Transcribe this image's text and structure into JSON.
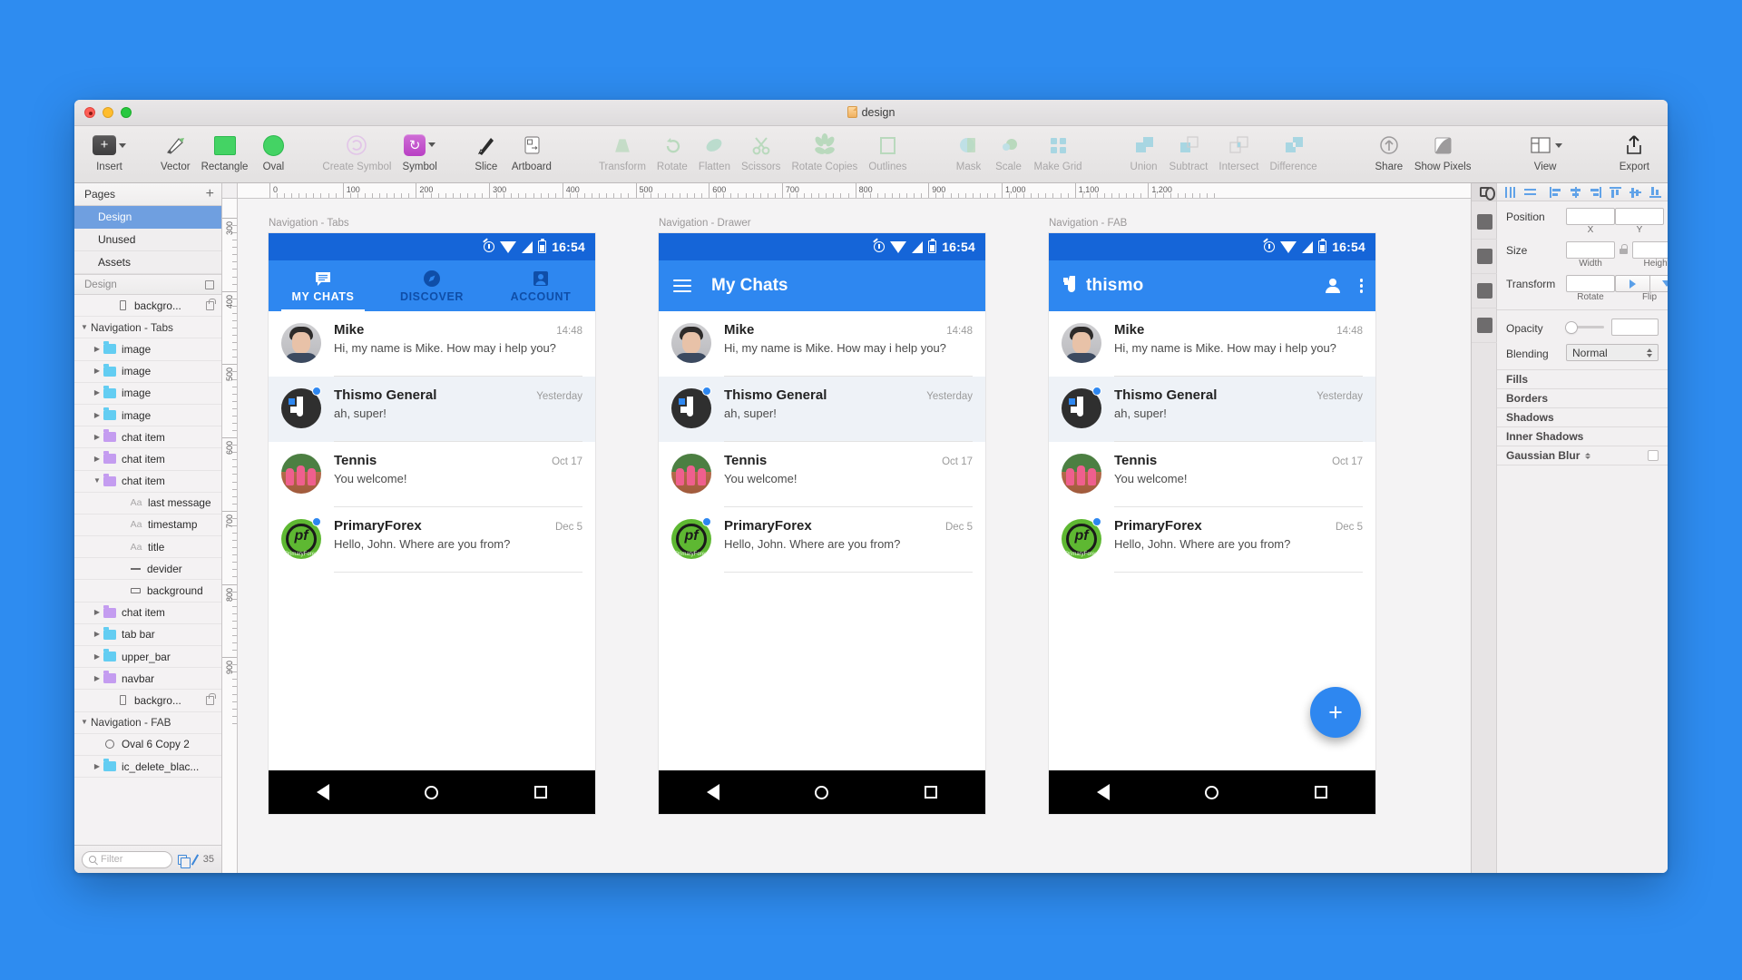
{
  "window": {
    "title": "design",
    "doc_icon": "document-icon"
  },
  "toolbar": {
    "groups": [
      {
        "items": [
          {
            "label": "Insert",
            "icon": "plus-square-icon",
            "dim": false,
            "kind": "insert"
          }
        ]
      },
      {
        "items": [
          {
            "label": "Vector",
            "icon": "pen-icon",
            "dim": false,
            "kind": "vector"
          },
          {
            "label": "Rectangle",
            "icon": "rectangle-icon",
            "dim": false,
            "kind": "rect"
          },
          {
            "label": "Oval",
            "icon": "oval-icon",
            "dim": false,
            "kind": "oval"
          }
        ]
      },
      {
        "items": [
          {
            "label": "Create Symbol",
            "icon": "create-symbol-icon",
            "dim": true,
            "kind": "createsym"
          },
          {
            "label": "Symbol",
            "icon": "symbol-icon",
            "dim": false,
            "kind": "symbol"
          }
        ]
      },
      {
        "items": [
          {
            "label": "Slice",
            "icon": "slice-icon",
            "dim": false,
            "kind": "slice"
          },
          {
            "label": "Artboard",
            "icon": "artboard-icon",
            "dim": false,
            "kind": "artboard"
          }
        ]
      },
      {
        "items": [
          {
            "label": "Transform",
            "icon": "transform-icon",
            "dim": true,
            "kind": "transform"
          },
          {
            "label": "Rotate",
            "icon": "rotate-icon",
            "dim": true,
            "kind": "rotate"
          },
          {
            "label": "Flatten",
            "icon": "flatten-icon",
            "dim": true,
            "kind": "flatten"
          },
          {
            "label": "Scissors",
            "icon": "scissors-icon",
            "dim": true,
            "kind": "scissors"
          },
          {
            "label": "Rotate Copies",
            "icon": "rotate-copies-icon",
            "dim": true,
            "kind": "rotatecopies"
          },
          {
            "label": "Outlines",
            "icon": "outlines-icon",
            "dim": true,
            "kind": "outlines"
          }
        ]
      },
      {
        "items": [
          {
            "label": "Mask",
            "icon": "mask-icon",
            "dim": true,
            "kind": "mask"
          },
          {
            "label": "Scale",
            "icon": "scale-icon",
            "dim": true,
            "kind": "scale"
          },
          {
            "label": "Make Grid",
            "icon": "make-grid-icon",
            "dim": true,
            "kind": "makegrid"
          }
        ]
      },
      {
        "items": [
          {
            "label": "Union",
            "icon": "union-icon",
            "dim": true,
            "kind": "union"
          },
          {
            "label": "Subtract",
            "icon": "subtract-icon",
            "dim": true,
            "kind": "subtract"
          },
          {
            "label": "Intersect",
            "icon": "intersect-icon",
            "dim": true,
            "kind": "intersect"
          },
          {
            "label": "Difference",
            "icon": "difference-icon",
            "dim": true,
            "kind": "difference"
          }
        ]
      },
      {
        "items": [
          {
            "label": "Share",
            "icon": "share-icon",
            "dim": false,
            "kind": "share"
          },
          {
            "label": "Show Pixels",
            "icon": "show-pixels-icon",
            "dim": false,
            "kind": "pixels"
          }
        ]
      },
      {
        "items": [
          {
            "label": "View",
            "icon": "view-icon",
            "dim": false,
            "kind": "view"
          }
        ]
      },
      {
        "items": [
          {
            "label": "Export",
            "icon": "export-icon",
            "dim": false,
            "kind": "export"
          }
        ]
      }
    ]
  },
  "sidebar": {
    "pages_title": "Pages",
    "pages": [
      {
        "label": "Design",
        "selected": true
      },
      {
        "label": "Unused",
        "selected": false
      },
      {
        "label": "Assets",
        "selected": false
      }
    ],
    "layers_title": "Design",
    "filter_placeholder": "Filter",
    "layer_count": "35",
    "layers": [
      {
        "label": "backgro...",
        "indent": 2,
        "type": "artboardlayer",
        "disc": "",
        "locked": true
      },
      {
        "label": "Navigation - Tabs",
        "indent": 0,
        "type": "group",
        "disc": "down",
        "locked": false
      },
      {
        "label": "image",
        "indent": 1,
        "type": "folder-blue",
        "disc": "right",
        "locked": false
      },
      {
        "label": "image",
        "indent": 1,
        "type": "folder-blue",
        "disc": "right",
        "locked": false
      },
      {
        "label": "image",
        "indent": 1,
        "type": "folder-blue",
        "disc": "right",
        "locked": false
      },
      {
        "label": "image",
        "indent": 1,
        "type": "folder-blue",
        "disc": "right",
        "locked": false
      },
      {
        "label": "chat item",
        "indent": 1,
        "type": "folder-purple",
        "disc": "right",
        "locked": false
      },
      {
        "label": "chat item",
        "indent": 1,
        "type": "folder-purple",
        "disc": "right",
        "locked": false
      },
      {
        "label": "chat item",
        "indent": 1,
        "type": "folder-purple",
        "disc": "down",
        "locked": false
      },
      {
        "label": "last message",
        "indent": 3,
        "type": "text",
        "disc": "",
        "locked": false
      },
      {
        "label": "timestamp",
        "indent": 3,
        "type": "text",
        "disc": "",
        "locked": false
      },
      {
        "label": "title",
        "indent": 3,
        "type": "text",
        "disc": "",
        "locked": false
      },
      {
        "label": "devider",
        "indent": 3,
        "type": "line",
        "disc": "",
        "locked": false
      },
      {
        "label": "background",
        "indent": 3,
        "type": "rect",
        "disc": "",
        "locked": false
      },
      {
        "label": "chat item",
        "indent": 1,
        "type": "folder-purple",
        "disc": "right",
        "locked": false
      },
      {
        "label": "tab bar",
        "indent": 1,
        "type": "folder-blue",
        "disc": "right",
        "locked": false
      },
      {
        "label": "upper_bar",
        "indent": 1,
        "type": "folder-blue",
        "disc": "right",
        "locked": false
      },
      {
        "label": "navbar",
        "indent": 1,
        "type": "folder-purple",
        "disc": "right",
        "locked": false
      },
      {
        "label": "backgro...",
        "indent": 2,
        "type": "artboardlayer",
        "disc": "",
        "locked": true
      },
      {
        "label": "Navigation - FAB",
        "indent": 0,
        "type": "group",
        "disc": "down",
        "locked": false
      },
      {
        "label": "Oval 6 Copy 2",
        "indent": 1,
        "type": "oval",
        "disc": "",
        "locked": false
      },
      {
        "label": "ic_delete_blac...",
        "indent": 1,
        "type": "folder-blue",
        "disc": "right",
        "locked": false
      }
    ]
  },
  "ruler": {
    "h_labels": [
      "0",
      "100",
      "200",
      "300",
      "400",
      "500",
      "600",
      "700",
      "800",
      "900",
      "1,000",
      "1,100",
      "1,200"
    ],
    "v_labels": [
      "300",
      "400",
      "500",
      "600",
      "700",
      "800",
      "900"
    ]
  },
  "artboards": [
    {
      "name": "Navigation - Tabs",
      "kind": "tabs",
      "statusbar": {
        "time": "16:54",
        "icons": [
          "alarm-icon",
          "wifi-icon",
          "signal-icon",
          "battery-icon"
        ]
      },
      "tabs": [
        {
          "label": "MY CHATS",
          "icon": "chat-icon",
          "active": true
        },
        {
          "label": "DISCOVER",
          "icon": "compass-icon",
          "active": false
        },
        {
          "label": "ACCOUNT",
          "icon": "person-icon",
          "active": false
        }
      ]
    },
    {
      "name": "Navigation - Drawer",
      "kind": "drawer",
      "statusbar": {
        "time": "16:54",
        "icons": [
          "alarm-icon",
          "wifi-icon",
          "signal-icon",
          "battery-icon"
        ]
      },
      "title": "My Chats",
      "menu_icon": "hamburger-icon"
    },
    {
      "name": "Navigation - FAB",
      "kind": "fab",
      "statusbar": {
        "time": "16:54",
        "icons": [
          "alarm-icon",
          "wifi-icon",
          "signal-icon",
          "battery-icon"
        ]
      },
      "brand": "thismo",
      "actions": [
        "person-icon",
        "overflow-menu-icon"
      ],
      "fab_label": "+"
    }
  ],
  "chats": [
    {
      "name": "Mike",
      "time": "14:48",
      "message": "Hi, my name is Mike. How may i help you?",
      "avatar": "mike",
      "badge": false,
      "highlight": false
    },
    {
      "name": "Thismo General",
      "time": "Yesterday",
      "message": "ah, super!",
      "avatar": "thismo",
      "badge": true,
      "highlight": true
    },
    {
      "name": "Tennis",
      "time": "Oct 17",
      "message": "You welcome!",
      "avatar": "tennis",
      "badge": false,
      "highlight": false
    },
    {
      "name": "PrimaryForex",
      "time": "Dec 5",
      "message": "Hello, John.  Where are you from?",
      "avatar": "pf",
      "badge": true,
      "highlight": false
    }
  ],
  "bottom_nav": [
    "back-icon",
    "home-icon",
    "recents-icon"
  ],
  "inspector": {
    "fields": {
      "position_label": "Position",
      "position_x_sub": "X",
      "position_y_sub": "Y",
      "position_x_value": "",
      "position_y_value": "",
      "size_label": "Size",
      "size_w_sub": "Width",
      "size_h_sub": "Height",
      "size_w_value": "",
      "size_h_value": "",
      "transform_label": "Transform",
      "rotate_sub": "Rotate",
      "rotate_value": "",
      "flip_sub": "Flip",
      "opacity_label": "Opacity",
      "opacity_value": "",
      "blending_label": "Blending",
      "blending_value": "Normal"
    },
    "sections": [
      {
        "label": "Fills",
        "checkbox": false,
        "stepper": false
      },
      {
        "label": "Borders",
        "checkbox": false,
        "stepper": false
      },
      {
        "label": "Shadows",
        "checkbox": false,
        "stepper": false
      },
      {
        "label": "Inner Shadows",
        "checkbox": false,
        "stepper": false
      },
      {
        "label": "Gaussian Blur",
        "checkbox": true,
        "stepper": true
      }
    ]
  },
  "colors": {
    "desktop": "#2e8cf0",
    "accent": "#2e87f0",
    "statusbar": "#1565d8",
    "selection": "#6f9fe0"
  }
}
